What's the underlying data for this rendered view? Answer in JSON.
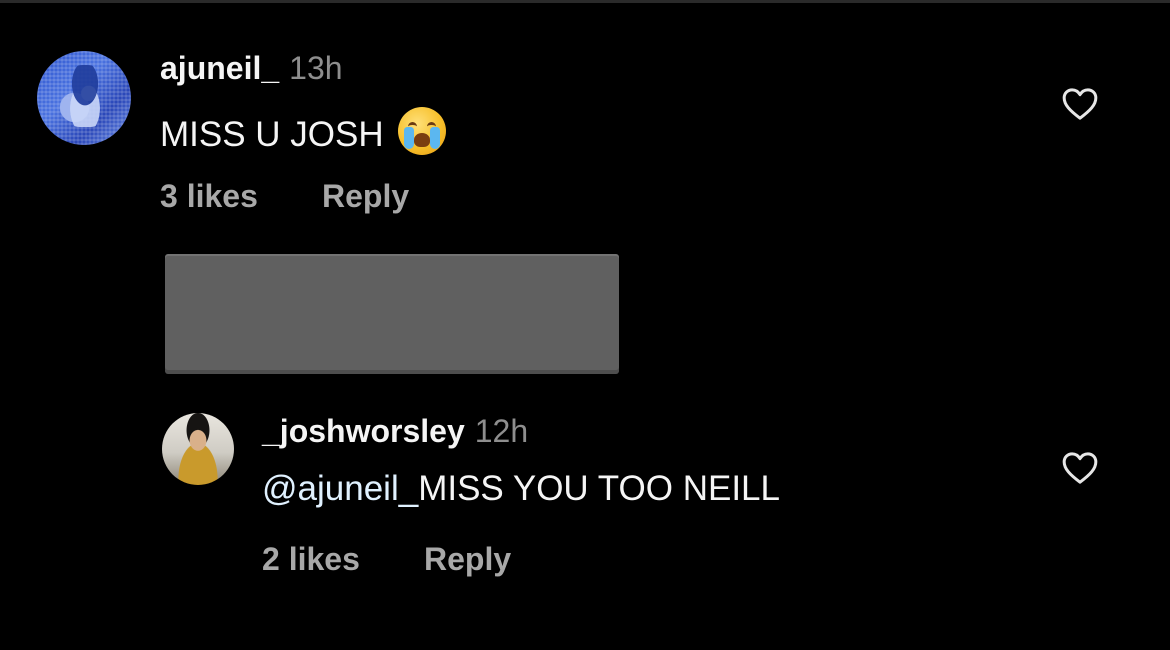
{
  "comments": [
    {
      "username": "ajuneil_",
      "time": "13h",
      "text": "MISS U JOSH",
      "emoji": "loudly-crying-face-icon",
      "likes": "3 likes",
      "reply": "Reply"
    },
    {
      "username": "_joshworsley",
      "time": "12h",
      "mention": "@ajuneil_",
      "text": "MISS YOU TOO NEILL",
      "likes": "2 likes",
      "reply": "Reply"
    }
  ],
  "colors": {
    "background": "#000000",
    "primary_text": "#f5f5f5",
    "secondary_text": "#a8a8a8",
    "timestamp": "#8e8e8e",
    "mention": "#e0f1ff",
    "redaction_box": "#606060"
  }
}
